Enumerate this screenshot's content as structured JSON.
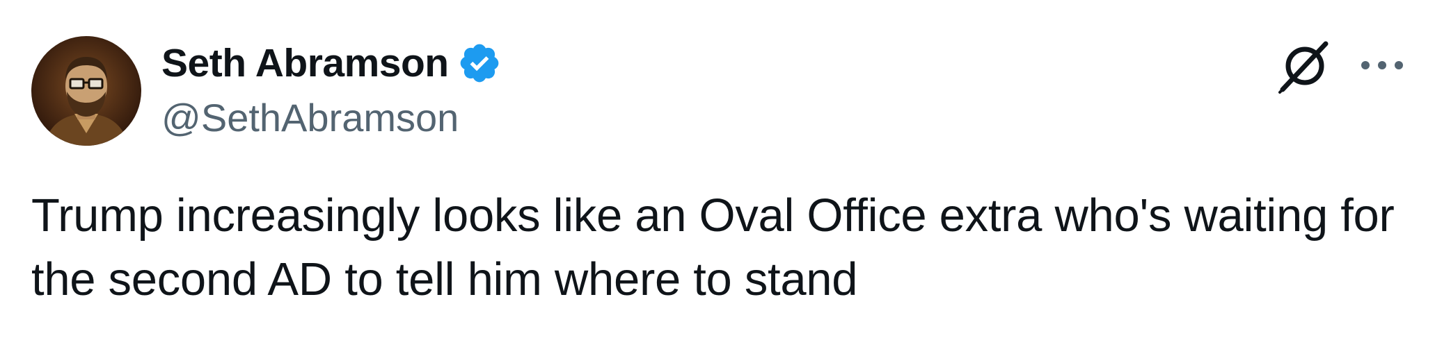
{
  "tweet": {
    "author": {
      "display_name": "Seth Abramson",
      "handle": "@SethAbramson",
      "verified": true,
      "avatar_alt": "profile photo"
    },
    "text": "Trump increasingly looks like an Oval Office extra who's waiting for the second AD to tell him where to stand",
    "icons": {
      "verified": "verified-badge-icon",
      "grok": "grok-icon",
      "more": "more-options-icon"
    },
    "colors": {
      "verified": "#1d9bf0",
      "handle": "#536471",
      "text": "#0f1419"
    }
  }
}
